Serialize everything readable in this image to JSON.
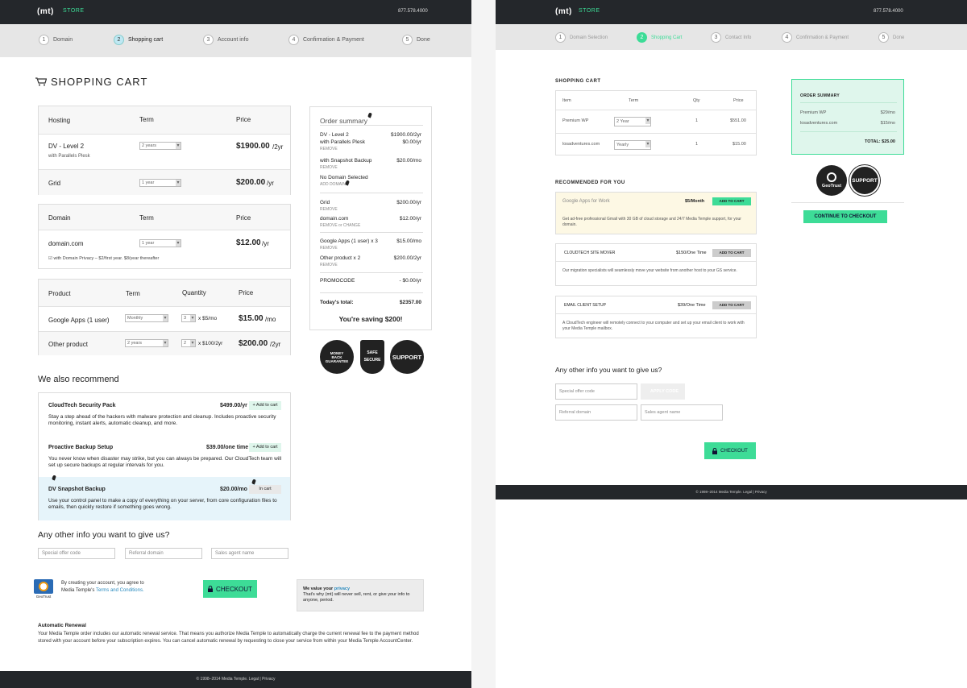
{
  "brand": {
    "logo": "(mt)",
    "store": "STORE",
    "phone": "877.578.4000"
  },
  "left": {
    "steps": [
      {
        "num": "1",
        "label": "Domain"
      },
      {
        "num": "2",
        "label": "Shopping cart"
      },
      {
        "num": "3",
        "label": "Account info"
      },
      {
        "num": "4",
        "label": "Confirmation & Payment"
      },
      {
        "num": "5",
        "label": "Done"
      }
    ],
    "title": "SHOPPING CART",
    "hosting": {
      "headers": [
        "Hosting",
        "Term",
        "Price"
      ],
      "rows": [
        {
          "name": "DV - Level 2",
          "sub": "with Parallels Plesk",
          "term": "2 years",
          "price": "$1900.00",
          "unit": "/2yr"
        },
        {
          "name": "Grid",
          "sub": "",
          "term": "1 year",
          "price": "$200.00",
          "unit": "/yr"
        }
      ]
    },
    "domain": {
      "headers": [
        "Domain",
        "Term",
        "Price"
      ],
      "name": "domain.com",
      "term": "1 year",
      "price": "$12.00",
      "unit": "/yr",
      "privacy": "☑ with Domain Privacy – $2/first year. $8/year thereafter"
    },
    "products": {
      "headers": [
        "Product",
        "Term",
        "Quantity",
        "Price"
      ],
      "rows": [
        {
          "name": "Google Apps (1 user)",
          "term": "Monthly",
          "qty": "3",
          "each": "x $5/mo",
          "price": "$15.00",
          "unit": "/mo"
        },
        {
          "name": "Other product",
          "term": "2 years",
          "qty": "2",
          "each": "x $100/2yr",
          "price": "$200.00",
          "unit": "/2yr"
        }
      ]
    },
    "recommend_title": "We also recommend",
    "recommend": [
      {
        "name": "CloudTech Security Pack",
        "price": "$499.00/yr",
        "btn": "+ Add to cart",
        "desc": "Stay a step ahead of the hackers with malware protection and cleanup. Includes proactive security monitoring, instant alerts, automatic cleanup, and more."
      },
      {
        "name": "Proactive Backup Setup",
        "price": "$39.00/one time",
        "btn": "+ Add to cart",
        "desc": "You never know when disaster may strike, but you can always be prepared. Our CloudTech team will set up secure backups at regular intervals for you."
      },
      {
        "name": "DV Snapshot Backup",
        "price": "$20.00/mo",
        "btn": "In cart",
        "desc": "Use your control panel to make a copy of everything on your server, from core configuration files to emails, then quickly restore if something goes wrong."
      }
    ],
    "other_title": "Any other info you want to give us?",
    "inputs": {
      "special": "Special offer code",
      "referral": "Referral domain",
      "sales": "Sales agent name"
    },
    "agree_text": "By creating your account, you agree to Media Temple's",
    "terms_link": "Terms and Conditions.",
    "checkout": "CHECKOUT",
    "privacy_title": "We value your",
    "privacy_link": "privacy",
    "privacy_text": "That's why (mt) will never sell, rent, or give your info to anyone, period.",
    "renewal_title": "Automatic Renewal",
    "renewal_text": "Your Media Temple order includes our automatic renewal service. That means you authorize Media Temple to automatically charge the current renewal fee to the payment method stored with your account before your subscription expires. You can cancel automatic renewal by requesting to close your service from within your Media Temple AccountCenter.",
    "footer": "© 1998–2014 Media Temple. Legal | Privacy",
    "geotrust": "GeoTrust",
    "summary": {
      "title": "Order summary",
      "items": [
        {
          "name": "DV - Level 2",
          "price": "$1900.00/2yr"
        },
        {
          "name": "with Parallels Plesk",
          "price": "$0.00/yr"
        },
        {
          "name": "with Snapshot Backup",
          "price": "$20.00/mo"
        },
        {
          "name": "No Domain Selected",
          "price": ""
        },
        {
          "name": "Grid",
          "price": "$200.00/yr"
        },
        {
          "name": "domain.com",
          "price": "$12.00/yr"
        },
        {
          "name": "Google Apps (1 user) x 3",
          "price": "$15.00/mo"
        },
        {
          "name": "Other product x 2",
          "price": "$200.00/2yr"
        }
      ],
      "remove": "REMOVE",
      "add_domain": "ADD DOMAIN",
      "remove_change": "REMOVE or CHANGE",
      "promo_label": "PROMOCODE",
      "promo_value": "- $0.00/yr",
      "total_label": "Today's total:",
      "total_value": "$2357.00",
      "saving": "You're saving $200!"
    },
    "badges": {
      "money": "MONEY BACK GUARANTEE",
      "safe": "SAFE SECURE",
      "support": "SUPPORT"
    }
  },
  "right": {
    "steps": [
      {
        "num": "1",
        "label": "Domain Selection"
      },
      {
        "num": "2",
        "label": "Shopping Cart"
      },
      {
        "num": "3",
        "label": "Contact Info"
      },
      {
        "num": "4",
        "label": "Confirmation & Payment"
      },
      {
        "num": "5",
        "label": "Done"
      }
    ],
    "cart_title": "SHOPPING CART",
    "headers": [
      "Item",
      "Term",
      "Qty",
      "Price"
    ],
    "rows": [
      {
        "item": "Premium WP",
        "term": "2 Year",
        "qty": "1",
        "price": "$551.00"
      },
      {
        "item": "losadventures.com",
        "term": "Yearly",
        "qty": "1",
        "price": "$15.00"
      }
    ],
    "recommended_title": "RECOMMENDED FOR YOU",
    "recommended": [
      {
        "name": "Google Apps for Work",
        "price": "$5/Month",
        "btn": "ADD TO CART",
        "desc": "Get ad-free professional Gmail with 30 GB of cloud storage and 24/7 Media Temple support, for your domain."
      },
      {
        "name": "CLOUDTECH SITE MOVER",
        "price": "$150/One Time",
        "btn": "ADD TO CART",
        "desc": "Our migration specialists will seamlessly move your website from another host to your GS service."
      },
      {
        "name": "EMAIL CLIENT SETUP",
        "price": "$39/One Time",
        "btn": "ADD TO CART",
        "desc": "A CloudTech engineer will remotely connect to your computer and set up your email client to work with your Media Temple mailbox."
      }
    ],
    "other_title": "Any other info you want to give us?",
    "inputs": {
      "special": "Special offer code",
      "apply": "APPLY CODE",
      "referral": "Referral domain",
      "sales": "Sales agent name"
    },
    "checkout": "CHECKOUT",
    "summary": {
      "title": "ORDER SUMMARY",
      "items": [
        {
          "name": "Premium WP",
          "price": "$29/mo"
        },
        {
          "name": "losadventures.com",
          "price": "$15/mo"
        }
      ],
      "total": "TOTAL: $25.00"
    },
    "continue": "CONTINUE TO CHECKOUT",
    "footer": "© 1998–2014 Media Temple. Legal | Privacy",
    "badges": {
      "geotrust": "GeoTrust",
      "support": "SUPPORT"
    }
  }
}
